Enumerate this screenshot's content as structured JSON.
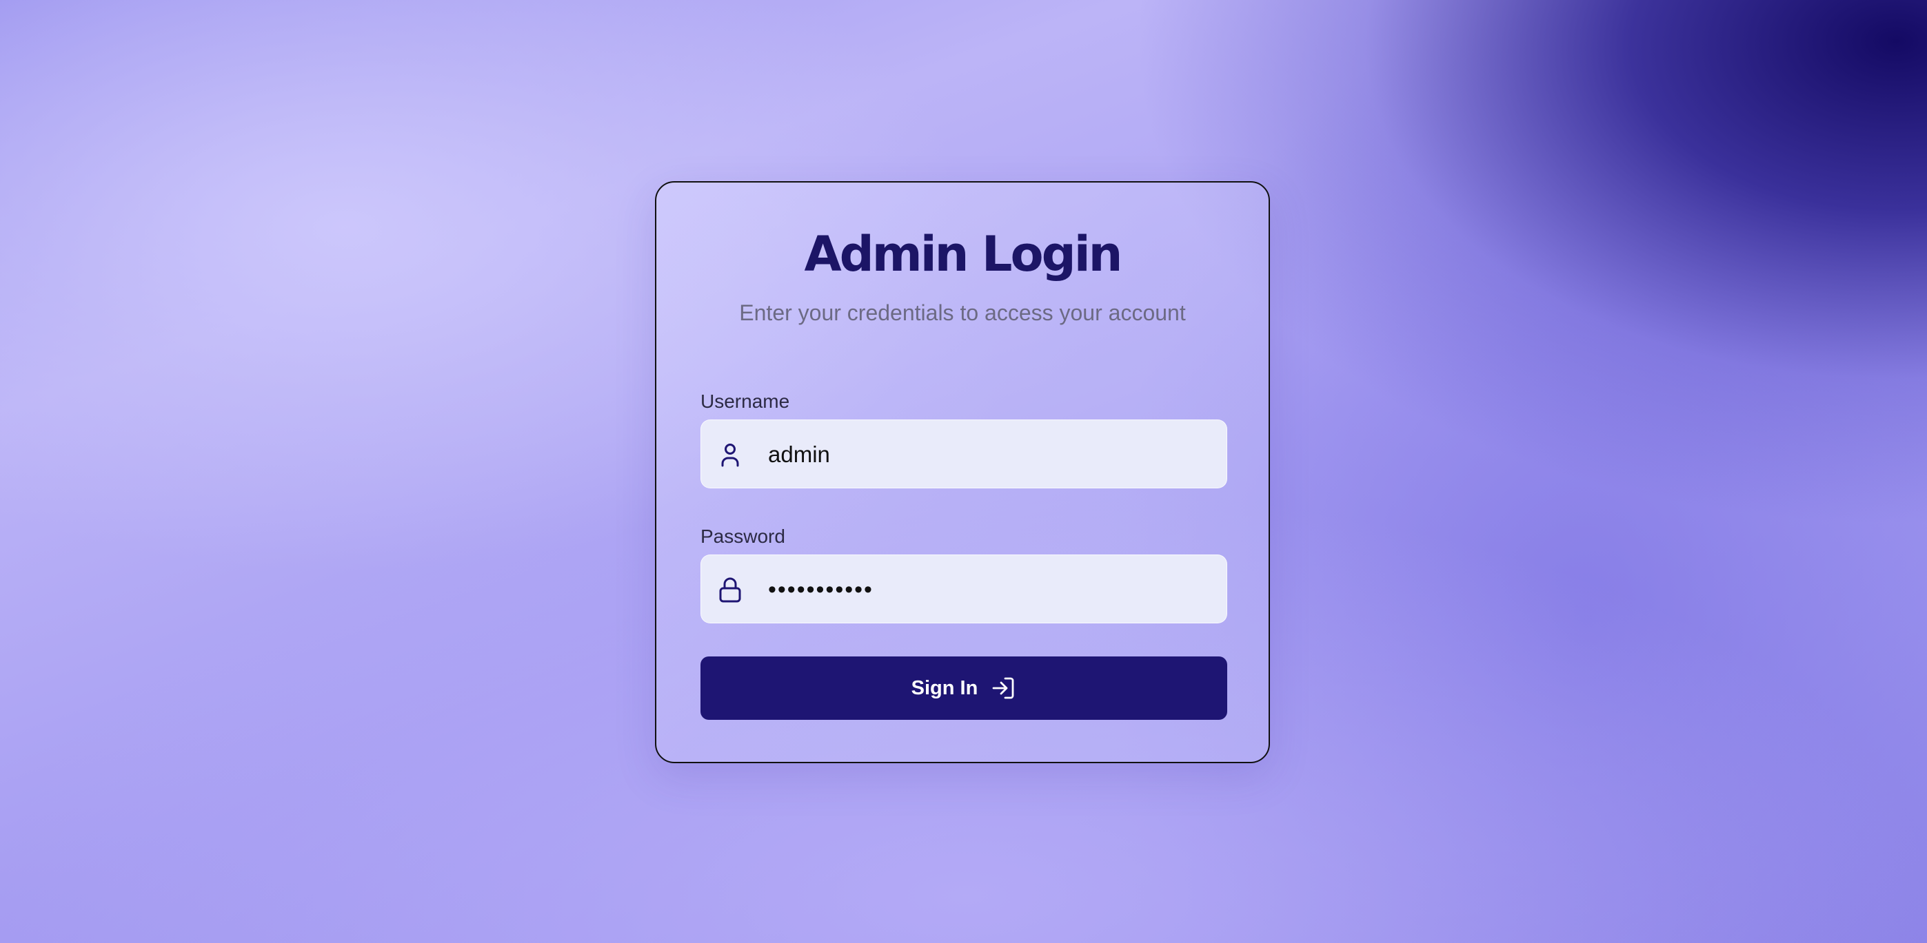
{
  "login": {
    "title": "Admin Login",
    "subtitle": "Enter your credentials to access your account",
    "username": {
      "label": "Username",
      "value": "admin",
      "icon": "user-icon"
    },
    "password": {
      "label": "Password",
      "value": "•••••••••••",
      "icon": "lock-icon"
    },
    "submit": {
      "label": "Sign In",
      "icon": "sign-in-icon"
    }
  },
  "colors": {
    "accent": "#1e1573",
    "title": "#1c1566",
    "input_background": "#e9ebfa"
  }
}
